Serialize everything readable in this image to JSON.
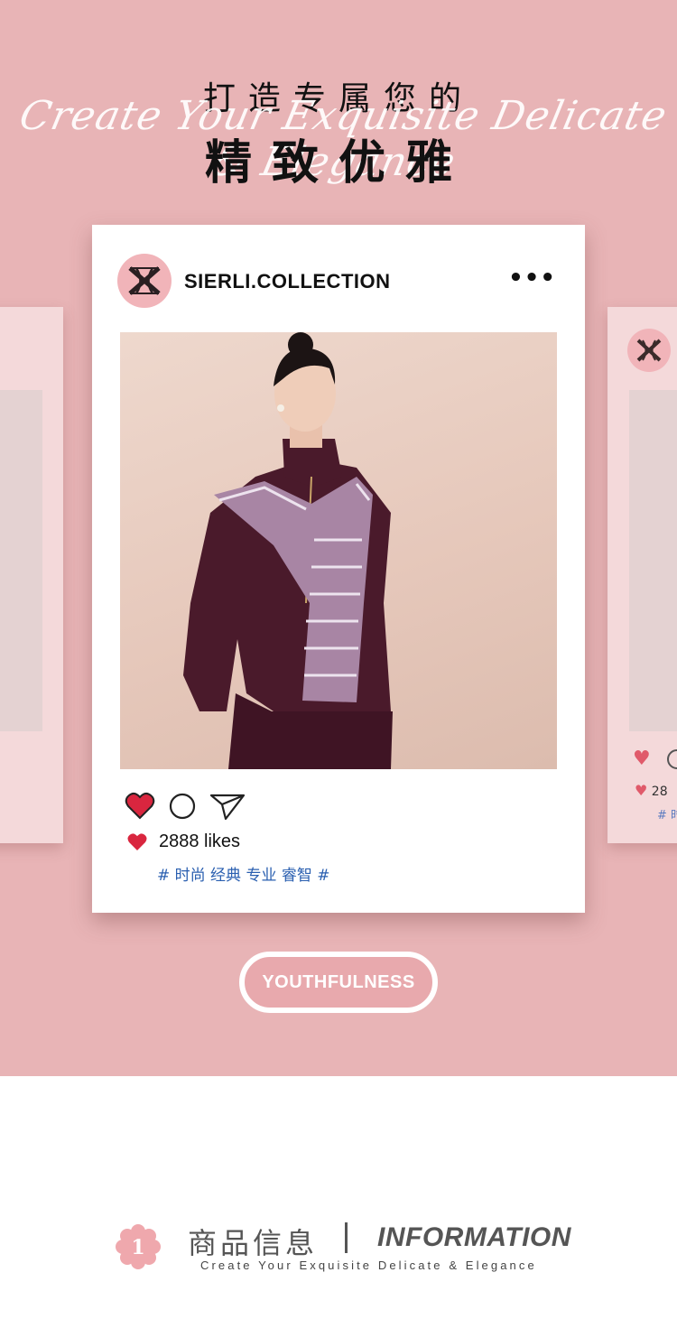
{
  "hero": {
    "title_line1": "打造专属您的",
    "script_text": "Create Your Exquisite Delicate & Elegance",
    "title_line2": "精致优雅"
  },
  "post": {
    "account": "SIERLI.COLLECTION",
    "more_icon": "more-dots-icon",
    "likes": "2888 likes",
    "tags": "# 时尚 经典 专业 睿智 #",
    "icons": [
      "heart-icon",
      "comment-icon",
      "send-icon"
    ]
  },
  "side_right": {
    "likes_partial": "28",
    "tag_partial": "# 时"
  },
  "button": {
    "label": "YOUTHFULNESS"
  },
  "info": {
    "number": "1",
    "cn_title": "商品信息",
    "en_title": "INFORMATION",
    "subtitle": "Create Your Exquisite Delicate & Elegance"
  },
  "colors": {
    "hero_bg": "#e8b4b6",
    "accent_pink": "#f1b4b9",
    "heart_red": "#d9263f",
    "tag_blue": "#2a5fb0"
  }
}
